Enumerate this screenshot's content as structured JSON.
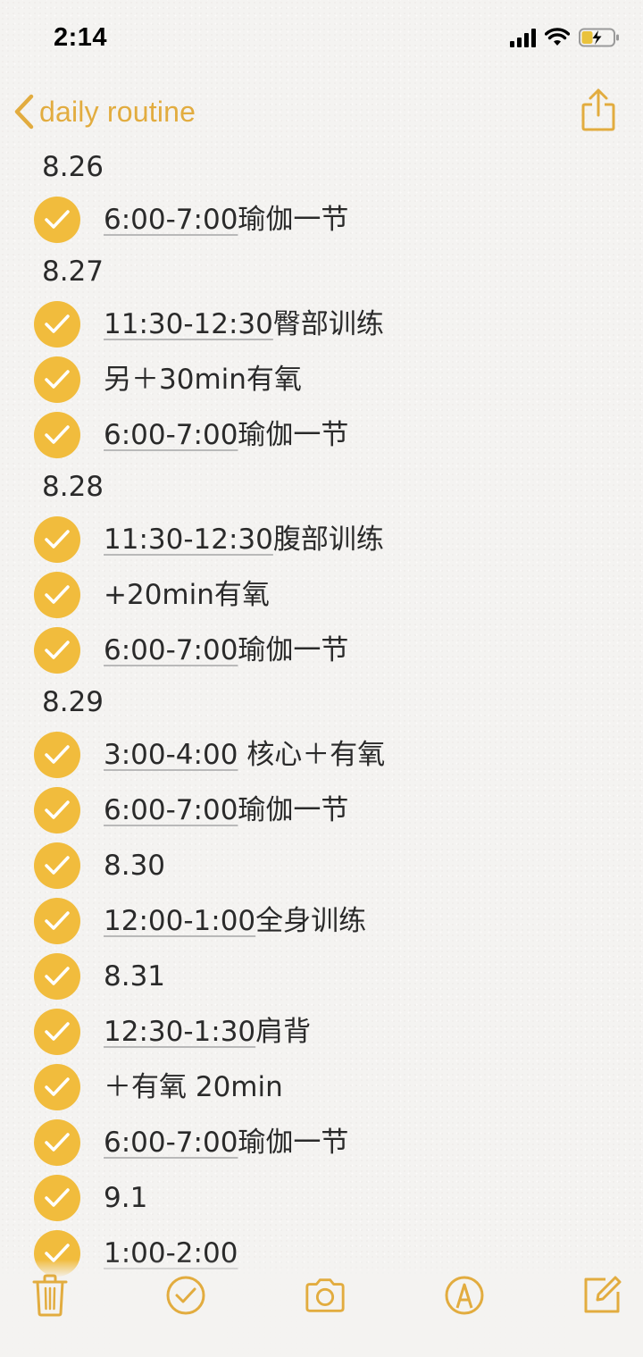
{
  "status_bar": {
    "time": "2:14",
    "icons": [
      "cellular-signal-icon",
      "wifi-icon",
      "battery-charging-icon"
    ]
  },
  "nav": {
    "back_label": "daily routine",
    "share_icon": "share-icon"
  },
  "accent_color": "#e2ac3f",
  "check_color": "#f1bc3d",
  "dates": {
    "d1": "8.26",
    "d2": "8.27",
    "d3": "8.28",
    "d4": "8.29"
  },
  "items": [
    {
      "time": "6:00-7:00",
      "text": "瑜伽一节",
      "checked": true
    },
    {
      "time": "11:30-12:30",
      "text": "臀部训练",
      "checked": true
    },
    {
      "time": "",
      "text": "另＋30min有氧",
      "checked": true
    },
    {
      "time": "6:00-7:00",
      "text": "瑜伽一节",
      "checked": true
    },
    {
      "time": "11:30-12:30",
      "text": "腹部训练",
      "checked": true
    },
    {
      "time": "",
      "text": "+20min有氧",
      "checked": true
    },
    {
      "time": "6:00-7:00",
      "text": "瑜伽一节",
      "checked": true
    },
    {
      "time": "3:00-4:00",
      "text": " 核心＋有氧",
      "checked": true
    },
    {
      "time": "6:00-7:00",
      "text": "瑜伽一节",
      "checked": true
    },
    {
      "time": "",
      "text": "8.30",
      "checked": true
    },
    {
      "time": "12:00-1:00",
      "text": "全身训练",
      "checked": true
    },
    {
      "time": "",
      "text": "8.31",
      "checked": true
    },
    {
      "time": "12:30-1:30",
      "text": "肩背",
      "checked": true
    },
    {
      "time": "",
      "text": "＋有氧 20min",
      "checked": true
    },
    {
      "time": "6:00-7:00",
      "text": "瑜伽一节",
      "checked": true
    },
    {
      "time": "",
      "text": "9.1",
      "checked": true
    },
    {
      "time": "1:00-2:00",
      "text": "",
      "checked": true
    }
  ],
  "toolbar": {
    "icons": [
      "trash-icon",
      "checklist-icon",
      "camera-icon",
      "markup-icon",
      "compose-icon"
    ]
  }
}
